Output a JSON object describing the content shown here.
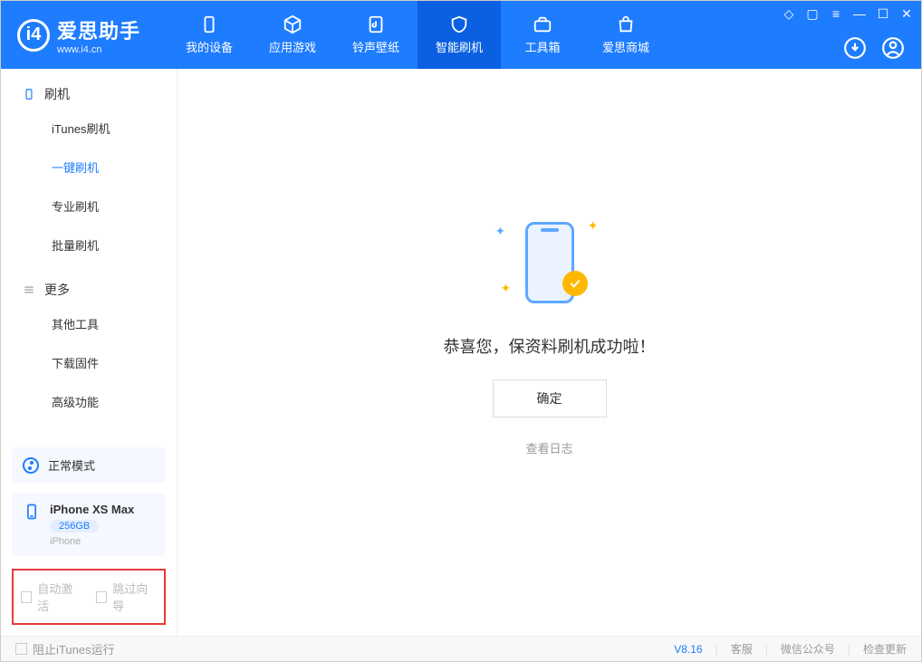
{
  "app": {
    "name": "爱思助手",
    "url": "www.i4.cn"
  },
  "nav": {
    "tabs": [
      {
        "label": "我的设备"
      },
      {
        "label": "应用游戏"
      },
      {
        "label": "铃声壁纸"
      },
      {
        "label": "智能刷机"
      },
      {
        "label": "工具箱"
      },
      {
        "label": "爱思商城"
      }
    ]
  },
  "sidebar": {
    "section1": "刷机",
    "items1": [
      {
        "label": "iTunes刷机"
      },
      {
        "label": "一键刷机"
      },
      {
        "label": "专业刷机"
      },
      {
        "label": "批量刷机"
      }
    ],
    "section2": "更多",
    "items2": [
      {
        "label": "其他工具"
      },
      {
        "label": "下载固件"
      },
      {
        "label": "高级功能"
      }
    ],
    "mode": "正常模式",
    "device": {
      "name": "iPhone XS Max",
      "capacity": "256GB",
      "type": "iPhone"
    },
    "options": {
      "auto_activate": "自动激活",
      "skip_guide": "跳过向导"
    }
  },
  "main": {
    "success_text": "恭喜您，保资料刷机成功啦！",
    "ok_button": "确定",
    "view_log": "查看日志"
  },
  "footer": {
    "block_itunes": "阻止iTunes运行",
    "version": "V8.16",
    "links": {
      "support": "客服",
      "wechat": "微信公众号",
      "update": "检查更新"
    }
  }
}
